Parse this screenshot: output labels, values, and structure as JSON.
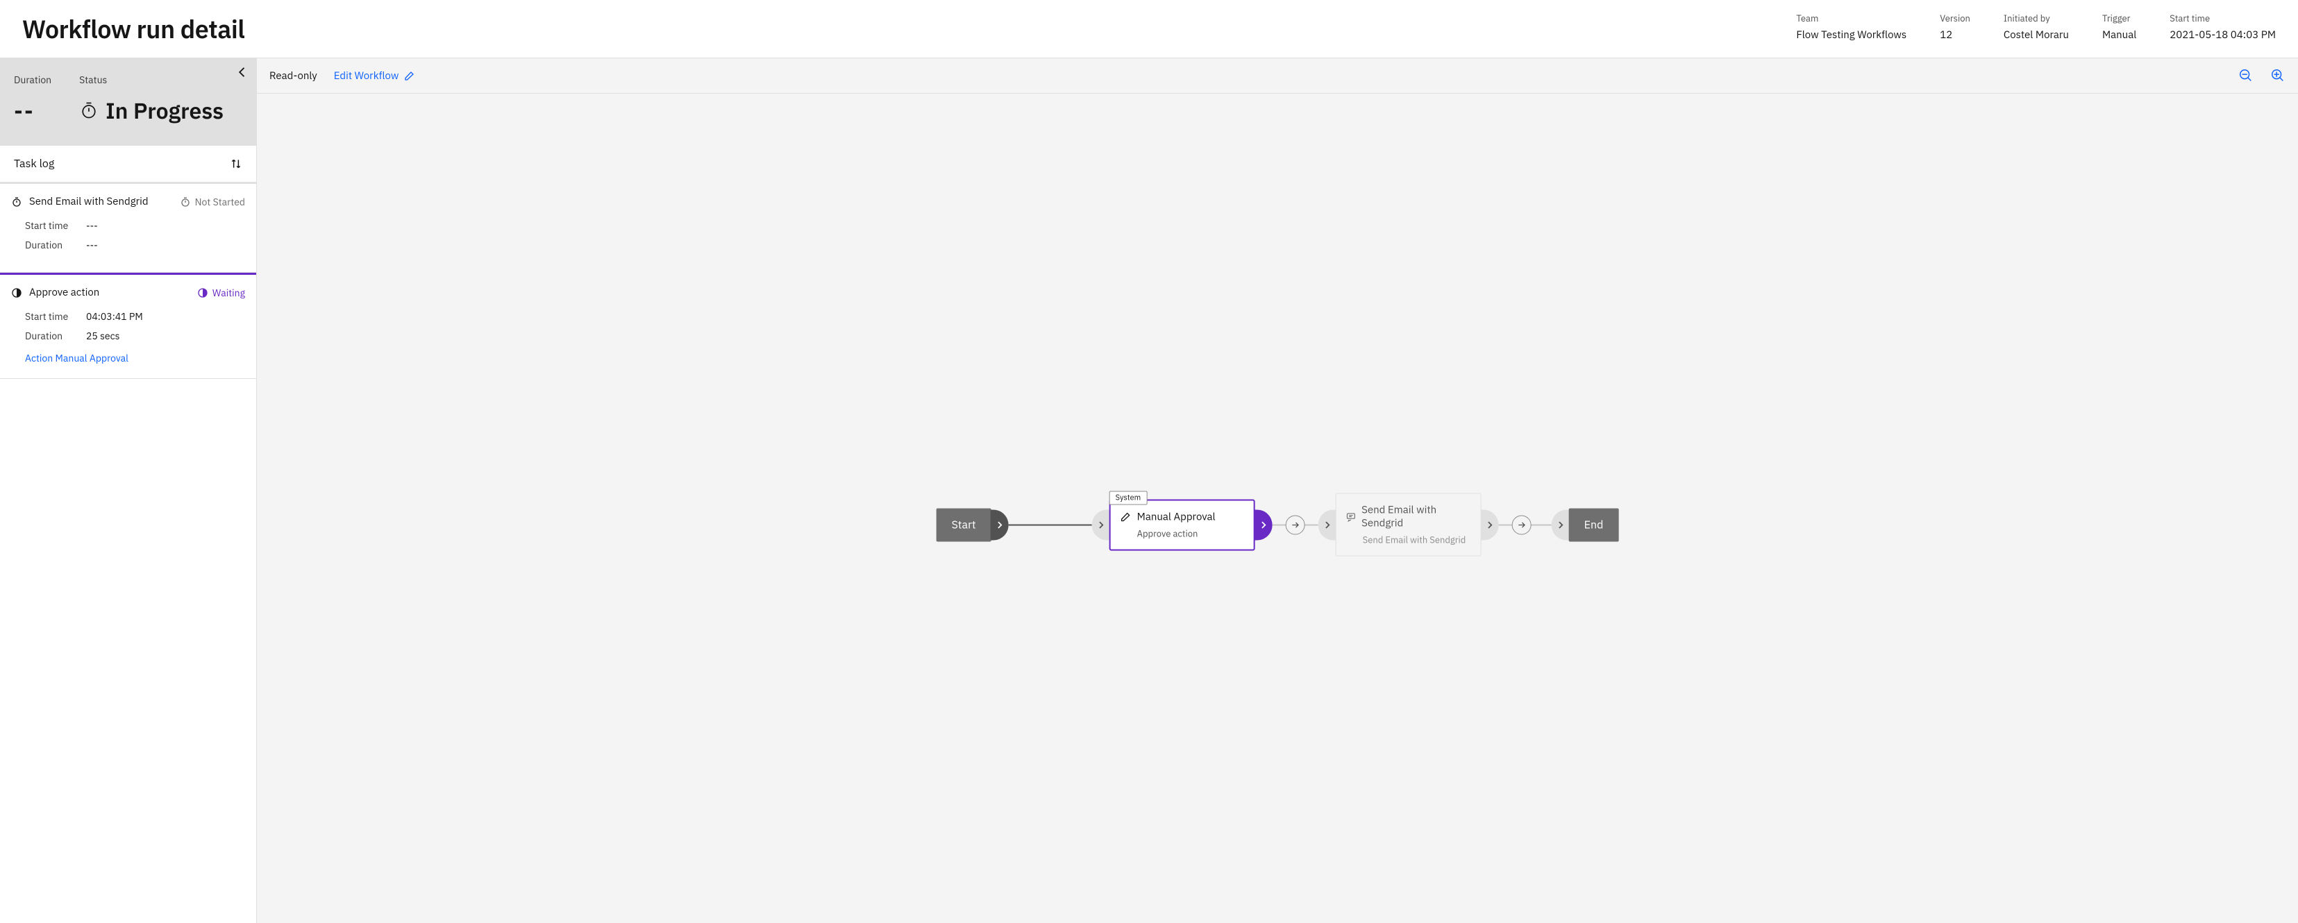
{
  "page_title": "Workflow run detail",
  "meta": {
    "team": {
      "label": "Team",
      "value": "Flow Testing Workflows"
    },
    "version": {
      "label": "Version",
      "value": "12"
    },
    "initiated": {
      "label": "Initiated by",
      "value": "Costel Moraru"
    },
    "trigger": {
      "label": "Trigger",
      "value": "Manual"
    },
    "start_time": {
      "label": "Start time",
      "value": "2021-05-18 04:03 PM"
    }
  },
  "summary": {
    "duration_label": "Duration",
    "duration_value": "--",
    "status_label": "Status",
    "status_value": "In Progress"
  },
  "tasklog": {
    "header": "Task log",
    "items": [
      {
        "name": "Send Email with Sendgrid",
        "status_text": "Not Started",
        "status_kind": "notstarted",
        "start_label": "Start time",
        "start_value": "---",
        "duration_label": "Duration",
        "duration_value": "---"
      },
      {
        "name": "Approve action",
        "status_text": "Waiting",
        "status_kind": "waiting",
        "start_label": "Start time",
        "start_value": "04:03:41 PM",
        "duration_label": "Duration",
        "duration_value": "25 secs",
        "action_label": "Action Manual Approval"
      }
    ]
  },
  "canvas": {
    "readonly_label": "Read-only",
    "edit_label": "Edit Workflow",
    "start_label": "Start",
    "end_label": "End",
    "approval": {
      "tag": "System",
      "title": "Manual Approval",
      "subtitle": "Approve action"
    },
    "email": {
      "title": "Send Email with Sendgrid",
      "subtitle": "Send Email with Sendgrid"
    }
  }
}
